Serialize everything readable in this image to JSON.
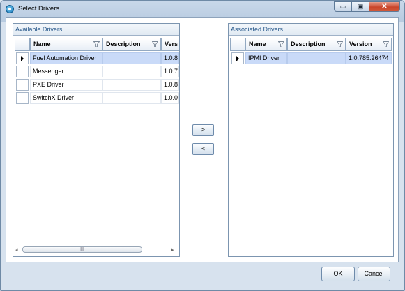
{
  "window": {
    "title": "Select Drivers",
    "icon": "app-logo-icon",
    "controls": {
      "minimize": "▭",
      "maximize": "▣",
      "close": "✕"
    }
  },
  "available": {
    "title": "Available Drivers",
    "columns": [
      "Name",
      "Description",
      "Vers"
    ],
    "rows": [
      {
        "name": "Fuel Automation Driver",
        "description": "",
        "version": "1.0.8",
        "selected": true
      },
      {
        "name": "Messenger",
        "description": "",
        "version": "1.0.7",
        "selected": false
      },
      {
        "name": "PXE Driver",
        "description": "",
        "version": "1.0.8",
        "selected": false
      },
      {
        "name": "SwitchX Driver",
        "description": "",
        "version": "1.0.0",
        "selected": false
      }
    ],
    "scrollbar": {
      "left": "◂",
      "thumb": "III",
      "right": "▸"
    }
  },
  "associated": {
    "title": "Associated Drivers",
    "columns": [
      "Name",
      "Description",
      "Version"
    ],
    "rows": [
      {
        "name": "IPMI Driver",
        "description": "",
        "version": "1.0.785.26474",
        "selected": true
      }
    ]
  },
  "actions": {
    "add": ">",
    "remove": "<"
  },
  "footer": {
    "ok": "OK",
    "cancel": "Cancel"
  },
  "colors": {
    "selection": "#c9daf8",
    "header_text": "#2a5a8c",
    "close_button": "#c9452a"
  }
}
